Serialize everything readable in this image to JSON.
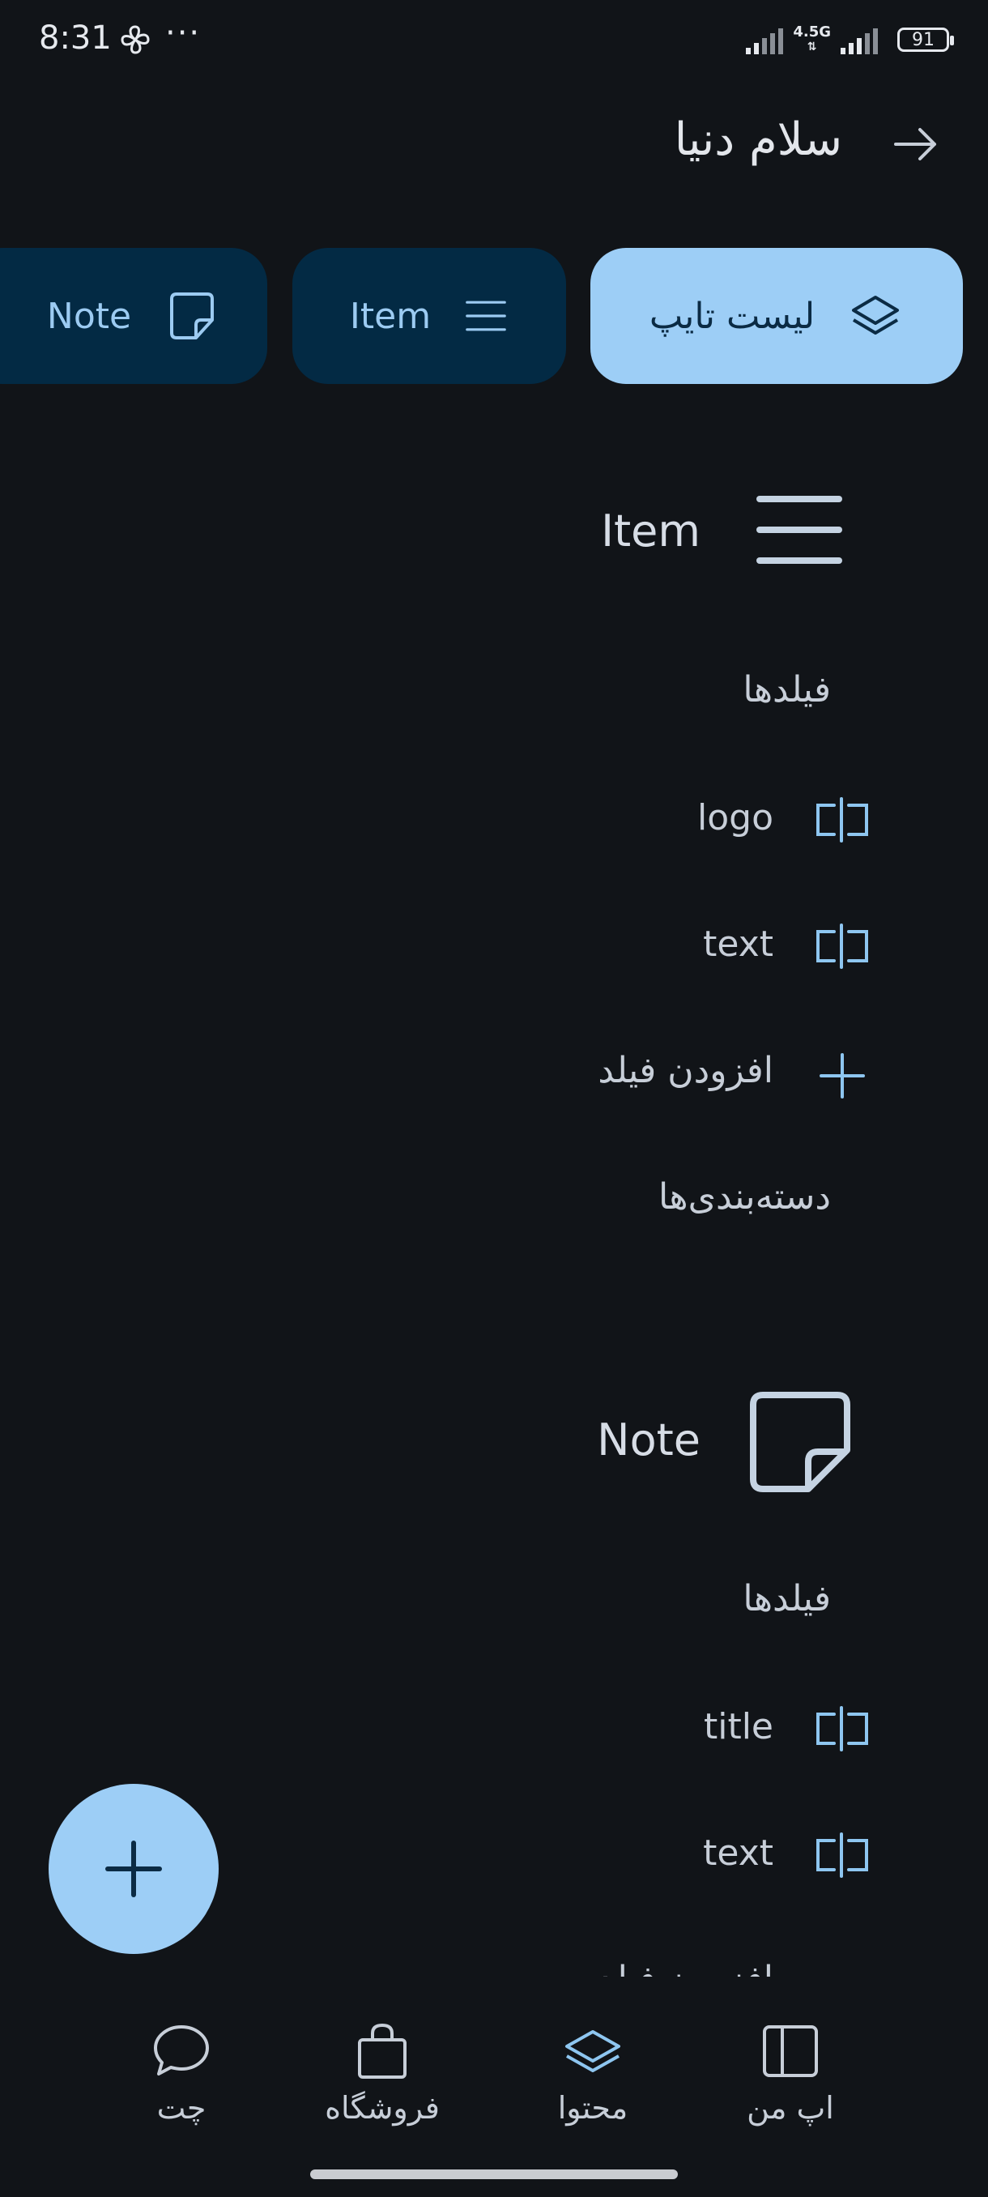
{
  "status_bar": {
    "time": "8:31",
    "network": "4.5G",
    "battery": "91"
  },
  "header": {
    "title": "سلام دنیا"
  },
  "chips": [
    {
      "label": "لیست تایپ",
      "icon": "layers-icon",
      "selected": true
    },
    {
      "label": "Item",
      "icon": "menu-lines-icon",
      "selected": false
    },
    {
      "label": "Note",
      "icon": "note-icon",
      "selected": false
    }
  ],
  "sections": [
    {
      "title": "Item",
      "icon": "menu-lines-icon",
      "fields_heading": "فیلدها",
      "fields": [
        "logo",
        "text"
      ],
      "add_field_label": "افزودن فیلد",
      "categories_heading": "دسته‌بندی‌ها"
    },
    {
      "title": "Note",
      "icon": "note-icon",
      "fields_heading": "فیلدها",
      "fields": [
        "title",
        "text"
      ],
      "add_field_label": "افزودن فیلد"
    }
  ],
  "bottom_nav": [
    {
      "label": "اپ من",
      "icon": "panel-icon"
    },
    {
      "label": "محتوا",
      "icon": "layers-icon",
      "active": true
    },
    {
      "label": "فروشگاه",
      "icon": "shopping-bag-icon"
    },
    {
      "label": "چت",
      "icon": "chat-bubble-icon"
    }
  ],
  "colors": {
    "background": "#111418",
    "accent": "#9dcef6",
    "chip_dark": "#032a44",
    "icon_blue": "#8ec6f0"
  }
}
